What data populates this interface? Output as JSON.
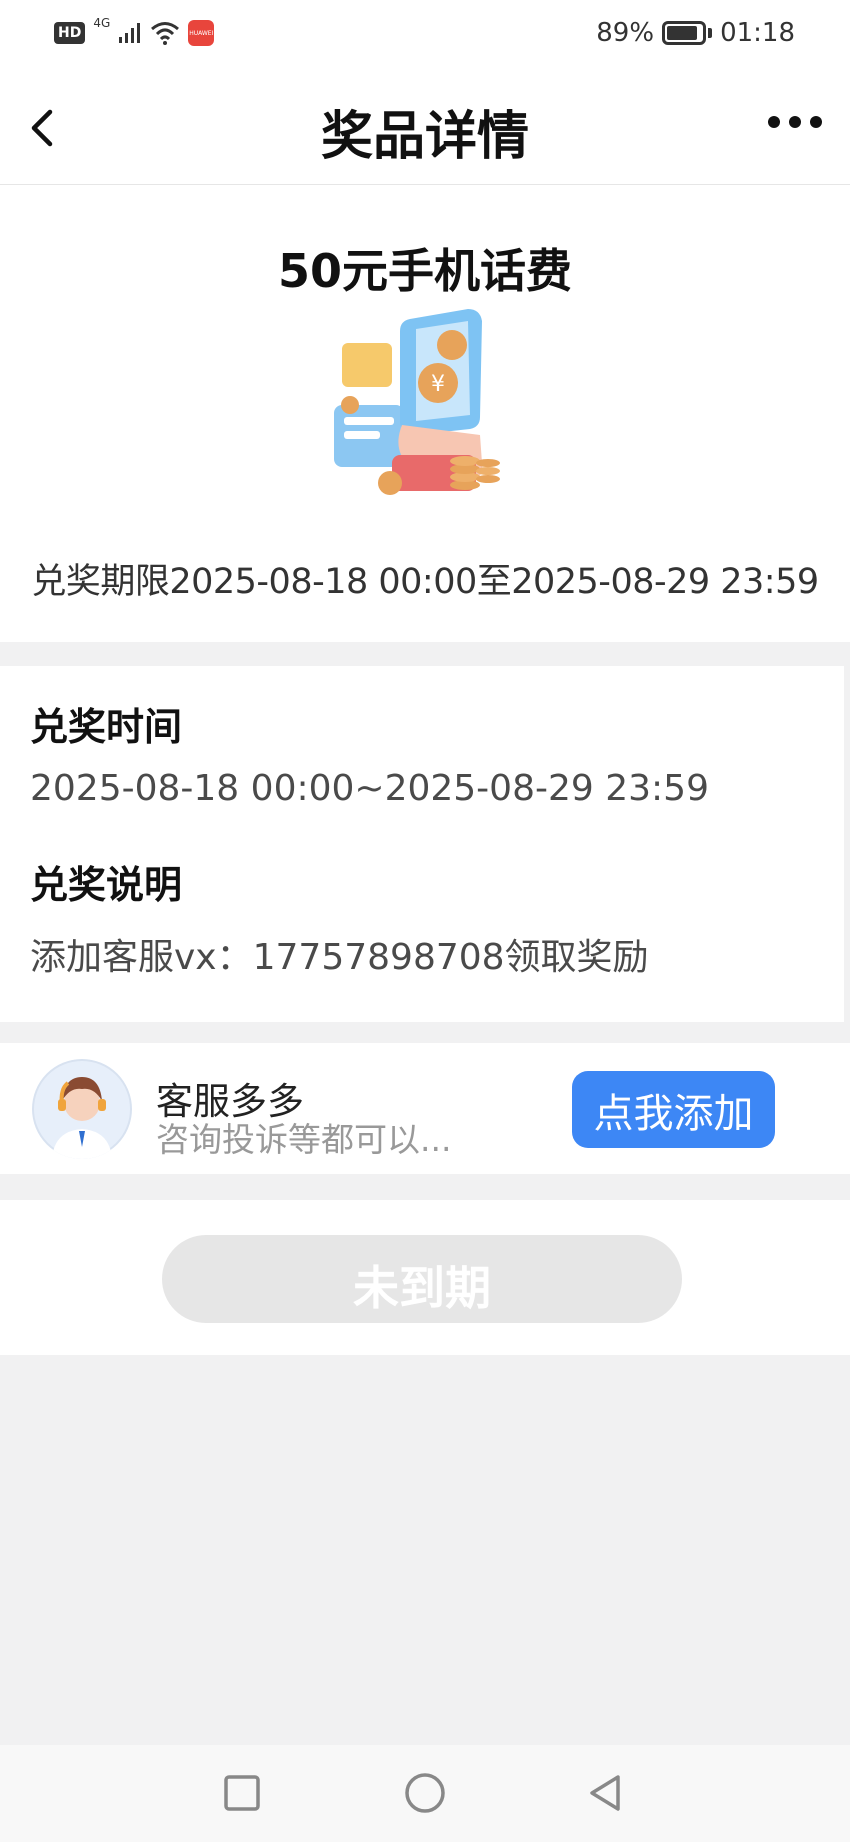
{
  "status_bar": {
    "hd_label": "HD",
    "network_label": "4G",
    "app_badge_label": "HUAWEI",
    "battery_label": "89%",
    "battery_level": 0.89,
    "time": "01:18"
  },
  "header": {
    "title": "奖品详情"
  },
  "prize": {
    "name": "50元手机话费",
    "redeem_period": "兑奖期限2025-08-18 00:00至2025-08-29 23:59"
  },
  "details": {
    "time_heading": "兑奖时间",
    "time_value": "2025-08-18 00:00~2025-08-29 23:59",
    "desc_heading": "兑奖说明",
    "desc_value": "添加客服vx：17757898708领取奖励"
  },
  "service": {
    "name": "客服多多",
    "description": "咨询投诉等都可以...",
    "add_button_label": "点我添加"
  },
  "action": {
    "button_label": "未到期"
  },
  "colors": {
    "accent": "#3d87f5",
    "page_background": "#f1f1f2",
    "disabled_button": "#e6e6e6"
  },
  "icons": {
    "back": "chevron-left-icon",
    "more": "more-dots-icon",
    "home": "circle-icon",
    "recent": "square-icon",
    "back_nav": "triangle-left-icon"
  }
}
